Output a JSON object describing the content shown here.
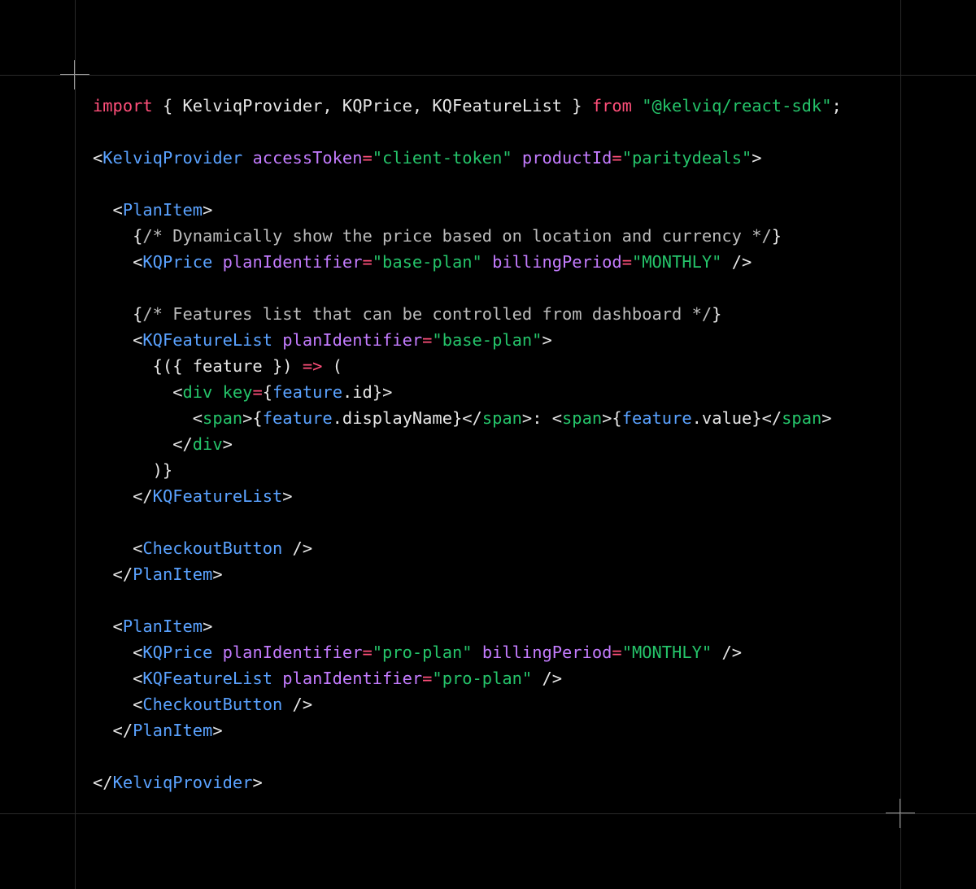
{
  "code_lines": [
    {
      "tokens": [
        {
          "t": "kw",
          "v": "import"
        },
        {
          "t": "pun",
          "v": " { KelviqProvider, KQPrice, KQFeatureList } "
        },
        {
          "t": "kw",
          "v": "from"
        },
        {
          "t": "pun",
          "v": " "
        },
        {
          "t": "str",
          "v": "\"@kelviq/react-sdk\""
        },
        {
          "t": "pun",
          "v": ";"
        }
      ]
    },
    {
      "tokens": []
    },
    {
      "tokens": [
        {
          "t": "pun",
          "v": "<"
        },
        {
          "t": "tag",
          "v": "KelviqProvider"
        },
        {
          "t": "pun",
          "v": " "
        },
        {
          "t": "attr",
          "v": "accessToken"
        },
        {
          "t": "op",
          "v": "="
        },
        {
          "t": "str",
          "v": "\"client-token\""
        },
        {
          "t": "pun",
          "v": " "
        },
        {
          "t": "attr",
          "v": "productId"
        },
        {
          "t": "op",
          "v": "="
        },
        {
          "t": "str",
          "v": "\"paritydeals\""
        },
        {
          "t": "pun",
          "v": ">"
        }
      ]
    },
    {
      "tokens": []
    },
    {
      "tokens": [
        {
          "t": "pun",
          "v": "  <"
        },
        {
          "t": "tag",
          "v": "PlanItem"
        },
        {
          "t": "pun",
          "v": ">"
        }
      ]
    },
    {
      "tokens": [
        {
          "t": "pun",
          "v": "    {"
        },
        {
          "t": "cmt",
          "v": "/* Dynamically show the price based on location and currency */"
        },
        {
          "t": "pun",
          "v": "}"
        }
      ]
    },
    {
      "tokens": [
        {
          "t": "pun",
          "v": "    <"
        },
        {
          "t": "tag",
          "v": "KQPrice"
        },
        {
          "t": "pun",
          "v": " "
        },
        {
          "t": "attr",
          "v": "planIdentifier"
        },
        {
          "t": "op",
          "v": "="
        },
        {
          "t": "str",
          "v": "\"base-plan\""
        },
        {
          "t": "pun",
          "v": " "
        },
        {
          "t": "attr",
          "v": "billingPeriod"
        },
        {
          "t": "op",
          "v": "="
        },
        {
          "t": "str",
          "v": "\"MONTHLY\""
        },
        {
          "t": "pun",
          "v": " />"
        }
      ]
    },
    {
      "tokens": []
    },
    {
      "tokens": [
        {
          "t": "pun",
          "v": "    {"
        },
        {
          "t": "cmt",
          "v": "/* Features list that can be controlled from dashboard */"
        },
        {
          "t": "pun",
          "v": "}"
        }
      ]
    },
    {
      "tokens": [
        {
          "t": "pun",
          "v": "    <"
        },
        {
          "t": "tag",
          "v": "KQFeatureList"
        },
        {
          "t": "pun",
          "v": " "
        },
        {
          "t": "attr",
          "v": "planIdentifier"
        },
        {
          "t": "op",
          "v": "="
        },
        {
          "t": "str",
          "v": "\"base-plan\""
        },
        {
          "t": "pun",
          "v": ">"
        }
      ]
    },
    {
      "tokens": [
        {
          "t": "pun",
          "v": "      {({ feature }) "
        },
        {
          "t": "op",
          "v": "=>"
        },
        {
          "t": "pun",
          "v": " ("
        }
      ]
    },
    {
      "tokens": [
        {
          "t": "pun",
          "v": "        <"
        },
        {
          "t": "str",
          "v": "div"
        },
        {
          "t": "pun",
          "v": " "
        },
        {
          "t": "str",
          "v": "key"
        },
        {
          "t": "op",
          "v": "="
        },
        {
          "t": "pun",
          "v": "{"
        },
        {
          "t": "tag",
          "v": "feature"
        },
        {
          "t": "pun",
          "v": ".id}>"
        }
      ]
    },
    {
      "tokens": [
        {
          "t": "pun",
          "v": "          <"
        },
        {
          "t": "str",
          "v": "span"
        },
        {
          "t": "pun",
          "v": ">{"
        },
        {
          "t": "tag",
          "v": "feature"
        },
        {
          "t": "pun",
          "v": ".displayName}</"
        },
        {
          "t": "str",
          "v": "span"
        },
        {
          "t": "pun",
          "v": ">: <"
        },
        {
          "t": "str",
          "v": "span"
        },
        {
          "t": "pun",
          "v": ">{"
        },
        {
          "t": "tag",
          "v": "feature"
        },
        {
          "t": "pun",
          "v": ".value}</"
        },
        {
          "t": "str",
          "v": "span"
        },
        {
          "t": "pun",
          "v": ">"
        }
      ]
    },
    {
      "tokens": [
        {
          "t": "pun",
          "v": "        </"
        },
        {
          "t": "str",
          "v": "div"
        },
        {
          "t": "pun",
          "v": ">"
        }
      ]
    },
    {
      "tokens": [
        {
          "t": "pun",
          "v": "      )}"
        }
      ]
    },
    {
      "tokens": [
        {
          "t": "pun",
          "v": "    </"
        },
        {
          "t": "tag",
          "v": "KQFeatureList"
        },
        {
          "t": "pun",
          "v": ">"
        }
      ]
    },
    {
      "tokens": []
    },
    {
      "tokens": [
        {
          "t": "pun",
          "v": "    <"
        },
        {
          "t": "tag",
          "v": "CheckoutButton"
        },
        {
          "t": "pun",
          "v": " />"
        }
      ]
    },
    {
      "tokens": [
        {
          "t": "pun",
          "v": "  </"
        },
        {
          "t": "tag",
          "v": "PlanItem"
        },
        {
          "t": "pun",
          "v": ">"
        }
      ]
    },
    {
      "tokens": []
    },
    {
      "tokens": [
        {
          "t": "pun",
          "v": "  <"
        },
        {
          "t": "tag",
          "v": "PlanItem"
        },
        {
          "t": "pun",
          "v": ">"
        }
      ]
    },
    {
      "tokens": [
        {
          "t": "pun",
          "v": "    <"
        },
        {
          "t": "tag",
          "v": "KQPrice"
        },
        {
          "t": "pun",
          "v": " "
        },
        {
          "t": "attr",
          "v": "planIdentifier"
        },
        {
          "t": "op",
          "v": "="
        },
        {
          "t": "str",
          "v": "\"pro-plan\""
        },
        {
          "t": "pun",
          "v": " "
        },
        {
          "t": "attr",
          "v": "billingPeriod"
        },
        {
          "t": "op",
          "v": "="
        },
        {
          "t": "str",
          "v": "\"MONTHLY\""
        },
        {
          "t": "pun",
          "v": " />"
        }
      ]
    },
    {
      "tokens": [
        {
          "t": "pun",
          "v": "    <"
        },
        {
          "t": "tag",
          "v": "KQFeatureList"
        },
        {
          "t": "pun",
          "v": " "
        },
        {
          "t": "attr",
          "v": "planIdentifier"
        },
        {
          "t": "op",
          "v": "="
        },
        {
          "t": "str",
          "v": "\"pro-plan\""
        },
        {
          "t": "pun",
          "v": " />"
        }
      ]
    },
    {
      "tokens": [
        {
          "t": "pun",
          "v": "    <"
        },
        {
          "t": "tag",
          "v": "CheckoutButton"
        },
        {
          "t": "pun",
          "v": " />"
        }
      ]
    },
    {
      "tokens": [
        {
          "t": "pun",
          "v": "  </"
        },
        {
          "t": "tag",
          "v": "PlanItem"
        },
        {
          "t": "pun",
          "v": ">"
        }
      ]
    },
    {
      "tokens": []
    },
    {
      "tokens": [
        {
          "t": "pun",
          "v": "</"
        },
        {
          "t": "tag",
          "v": "KelviqProvider"
        },
        {
          "t": "pun",
          "v": ">"
        }
      ]
    }
  ],
  "colors": {
    "background": "#000000",
    "keyword": "#ff4f7a",
    "string": "#25c46a",
    "tag": "#5aa2ff",
    "attribute": "#c47cff",
    "text": "#e6e6e6",
    "comment": "#bcbcbc",
    "guide": "#2a2a2a"
  }
}
